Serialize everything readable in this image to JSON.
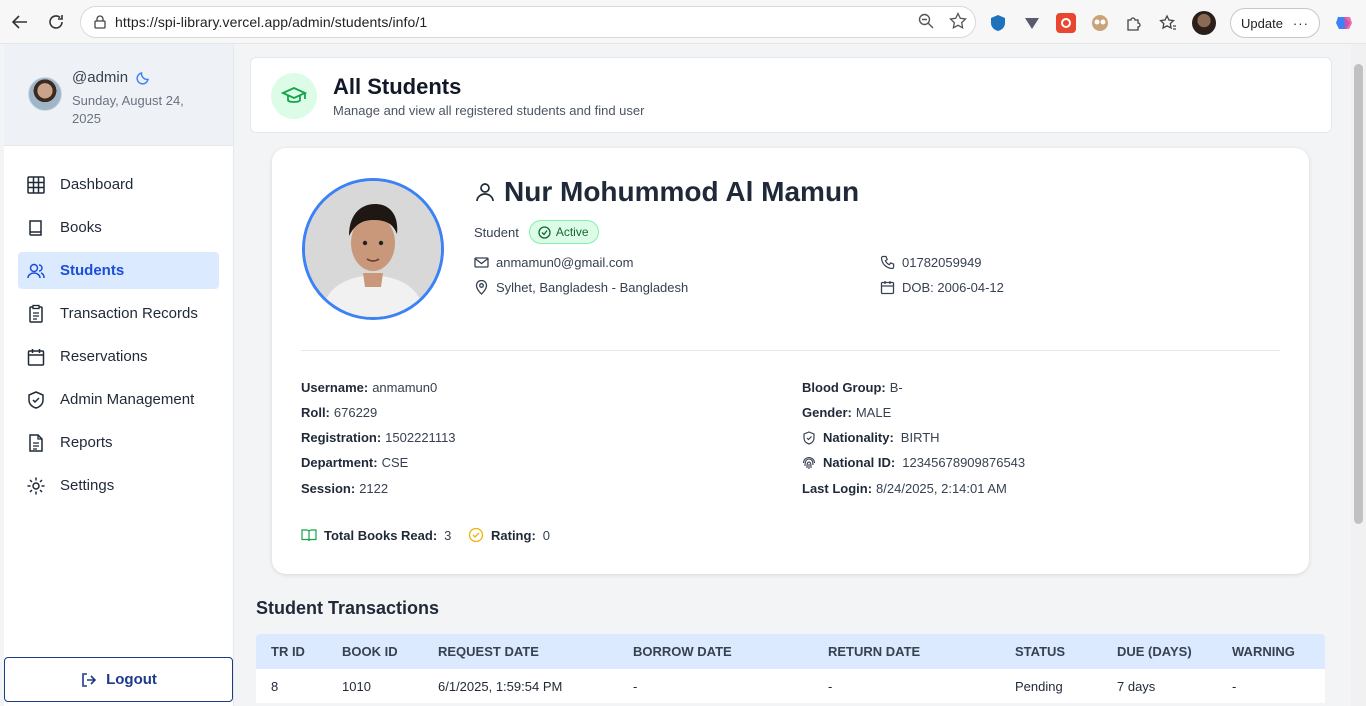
{
  "browser": {
    "url": "https://spi-library.vercel.app/admin/students/info/1",
    "update_label": "Update"
  },
  "sidebar": {
    "username": "@admin",
    "date": "Sunday, August 24, 2025",
    "items": [
      {
        "label": "Dashboard"
      },
      {
        "label": "Books"
      },
      {
        "label": "Students"
      },
      {
        "label": "Transaction Records"
      },
      {
        "label": "Reservations"
      },
      {
        "label": "Admin Management"
      },
      {
        "label": "Reports"
      },
      {
        "label": "Settings"
      }
    ],
    "logout_label": "Logout"
  },
  "header": {
    "title": "All Students",
    "subtitle": "Manage and view all registered students and find user"
  },
  "student": {
    "name": "Nur Mohummod Al Mamun",
    "role": "Student",
    "status": "Active",
    "email": "anmamun0@gmail.com",
    "location": "Sylhet, Bangladesh - Bangladesh",
    "phone": "01782059949",
    "dob": "DOB: 2006-04-12",
    "details": {
      "username_label": "Username:",
      "username": "anmamun0",
      "roll_label": "Roll:",
      "roll": "676229",
      "registration_label": "Registration:",
      "registration": "1502221113",
      "department_label": "Department:",
      "department": "CSE",
      "session_label": "Session:",
      "session": "2122",
      "blood_label": "Blood Group:",
      "blood": "B-",
      "gender_label": "Gender:",
      "gender": "MALE",
      "nationality_label": "Nationality:",
      "nationality": "BIRTH",
      "nid_label": "National ID:",
      "nid": "12345678909876543",
      "last_login_label": "Last Login:",
      "last_login": "8/24/2025, 2:14:01 AM"
    },
    "total_books_label": "Total Books Read:",
    "total_books": "3",
    "rating_label": "Rating:",
    "rating": "0"
  },
  "transactions": {
    "title": "Student Transactions",
    "columns": [
      "TR ID",
      "BOOK ID",
      "REQUEST DATE",
      "BORROW DATE",
      "RETURN DATE",
      "STATUS",
      "DUE (DAYS)",
      "WARNING"
    ],
    "rows": [
      [
        "8",
        "1010",
        "6/1/2025, 1:59:54 PM",
        "-",
        "-",
        "Pending",
        "7 days",
        "-"
      ]
    ]
  },
  "colors": {
    "accent": "#1d4ed8",
    "active_menu_bg": "#dbeafe",
    "status_active": "#166534"
  }
}
